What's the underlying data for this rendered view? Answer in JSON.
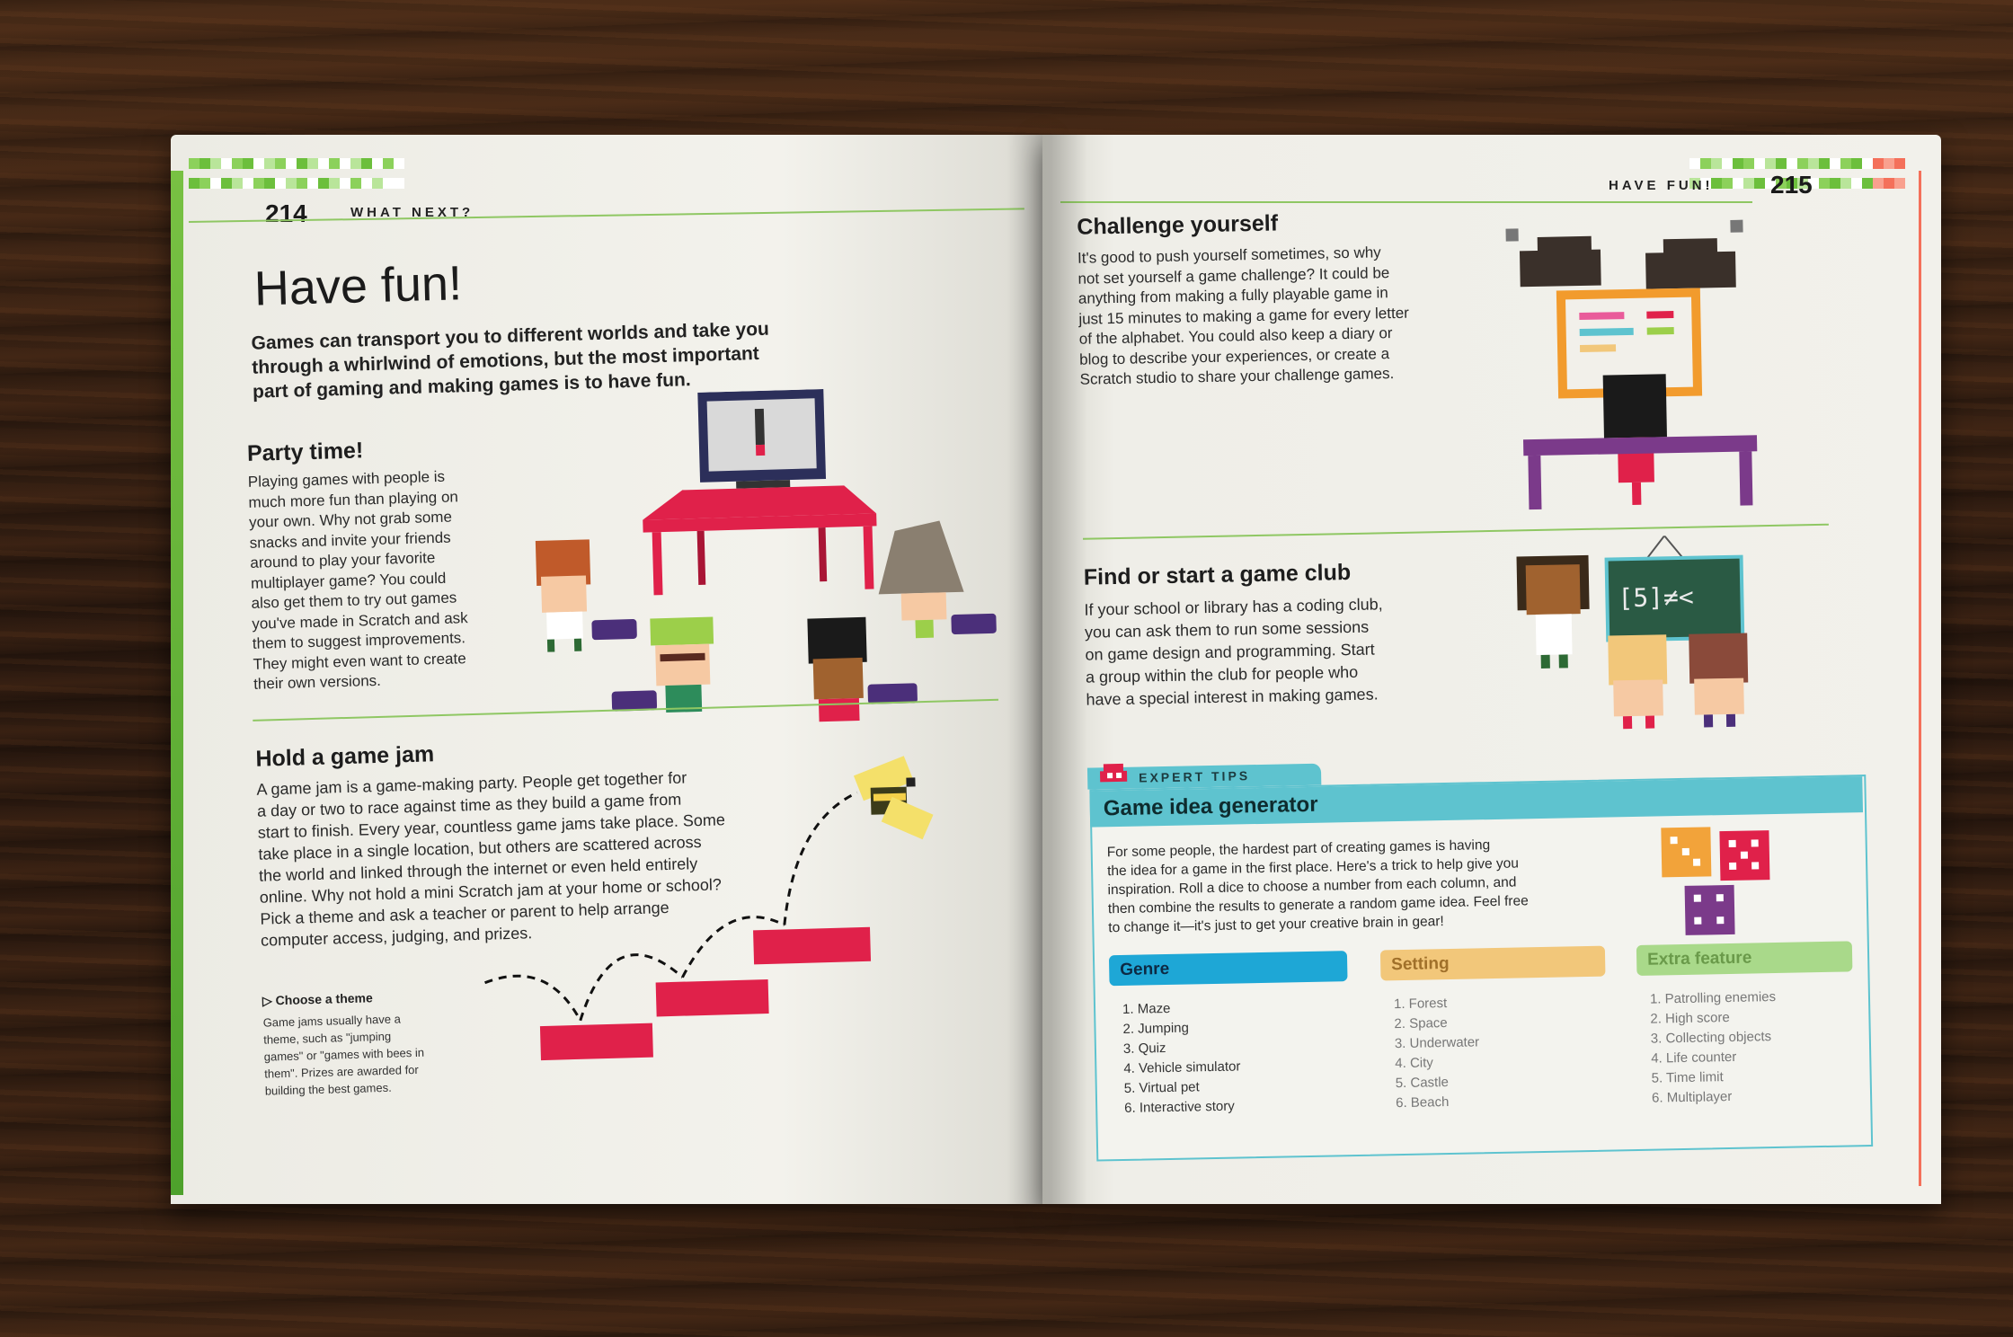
{
  "left_page": {
    "page_number": "214",
    "section_tag": "WHAT NEXT?",
    "title": "Have fun!",
    "intro_lines": [
      "Games can transport you to different worlds and take you",
      "through a whirlwind of emotions, but the most important",
      "part of gaming and making games is to have fun."
    ],
    "party": {
      "heading": "Party time!",
      "lines": [
        "Playing games with people is",
        "much more fun than playing on",
        "your own. Why not grab some",
        "snacks and invite your friends",
        "around to play your favorite",
        "multiplayer game? You could",
        "also get them to try out games",
        "you've made in Scratch and ask",
        "them to suggest improvements.",
        "They might even want to create",
        "their own versions."
      ]
    },
    "jam": {
      "heading": "Hold a game jam",
      "lines": [
        "A game jam is a game-making party. People get together for",
        "a day or two to race against time as they build a game from",
        "start to finish. Every year, countless game jams take place. Some",
        "take place in a single location, but others are scattered across",
        "the world and linked through the internet or even held entirely",
        "online. Why not hold a mini Scratch jam at your home or school?",
        "Pick a theme and ask a teacher or parent to help arrange",
        "computer access, judging, and prizes."
      ]
    },
    "caption": {
      "title": "▷ Choose a theme",
      "lines": [
        "Game jams usually have a",
        "theme, such as \"jumping",
        "games\" or \"games with bees in",
        "them\". Prizes are awarded for",
        "building the best games."
      ]
    }
  },
  "right_page": {
    "page_number": "215",
    "section_tag": "HAVE FUN!",
    "challenge": {
      "heading": "Challenge yourself",
      "lines": [
        "It's good to push yourself sometimes, so why",
        "not set yourself a game challenge? It could be",
        "anything from making a fully playable game in",
        "just 15 minutes to making a game for every letter",
        "of the alphabet. You could also keep a diary or",
        "blog to describe your experiences, or create a",
        "Scratch studio to share your challenge games."
      ]
    },
    "club": {
      "heading": "Find or start a game club",
      "lines": [
        "If your school or library has a coding club,",
        "you can ask them to run some sessions",
        "on game design and programming. Start",
        "a group within the club for people who",
        "have a special interest in making games."
      ],
      "board_text": "[5]≠<"
    },
    "tips": {
      "tab_label": "EXPERT TIPS",
      "heading": "Game idea generator",
      "lines": [
        "For some people, the hardest part of creating games is having",
        "the idea for a game in the first place. Here's a trick to help give you",
        "inspiration. Roll a dice to choose a number from each column, and",
        "then combine the results to generate a random game idea. Feel free",
        "to change it—it's just to get your creative brain in gear!"
      ],
      "columns": [
        {
          "heading": "Genre",
          "color": "#1ea7d6",
          "items": [
            "1. Maze",
            "2. Jumping",
            "3. Quiz",
            "4. Vehicle simulator",
            "5. Virtual pet",
            "6. Interactive story"
          ]
        },
        {
          "heading": "Setting",
          "color": "#f2c77a",
          "items": [
            "1. Forest",
            "2. Space",
            "3. Underwater",
            "4. City",
            "5. Castle",
            "6. Beach"
          ]
        },
        {
          "heading": "Extra feature",
          "color": "#a9d98a",
          "items": [
            "1. Patrolling enemies",
            "2. High score",
            "3. Collecting objects",
            "4. Life counter",
            "5. Time limit",
            "6. Multiplayer"
          ]
        }
      ]
    }
  },
  "colors": {
    "accent_green": "#78c143",
    "accent_teal": "#5ec3cf",
    "accent_red": "#e0214a",
    "accent_orange": "#f4705a"
  }
}
